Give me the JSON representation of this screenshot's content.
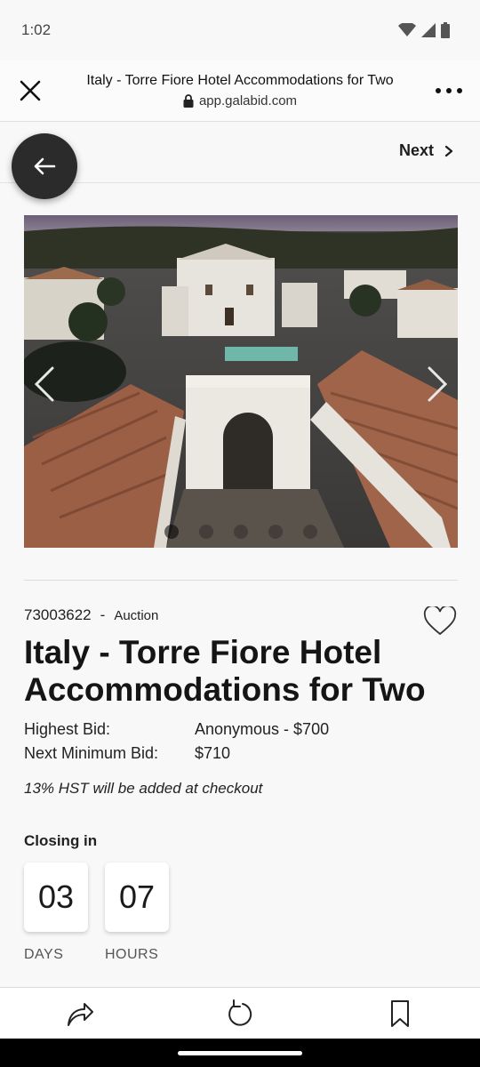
{
  "status_bar": {
    "time": "1:02"
  },
  "browser": {
    "heading": "Italy - Torre Fiore Hotel Accommodations for Two",
    "url": "app.galabid.com"
  },
  "nav": {
    "next_label": "Next"
  },
  "carousel": {
    "image_alt": "Aerial view of Torre Fiore Hotel at dusk",
    "dots": 5,
    "active_index": 0
  },
  "item": {
    "lot_id": "73003622",
    "separator": "-",
    "type": "Auction",
    "title": "Italy - Torre Fiore Hotel Accommodations for Two"
  },
  "bids": {
    "highest_label": "Highest Bid:",
    "highest_value": "Anonymous - $700",
    "next_min_label": "Next Minimum Bid:",
    "next_min_value": "$710"
  },
  "tax_note": "13% HST will be added at checkout",
  "closing": {
    "label": "Closing in",
    "days_value": "03",
    "days_label": "DAYS",
    "hours_value": "07",
    "hours_label": "HOURS"
  },
  "icons": {
    "close": "close-icon",
    "menu": "more-dots-icon",
    "lock": "lock-icon",
    "back": "arrow-left-icon",
    "next": "chevron-right-icon",
    "favorite": "heart-icon",
    "share": "share-icon",
    "refresh": "refresh-icon",
    "bookmark": "bookmark-icon"
  }
}
